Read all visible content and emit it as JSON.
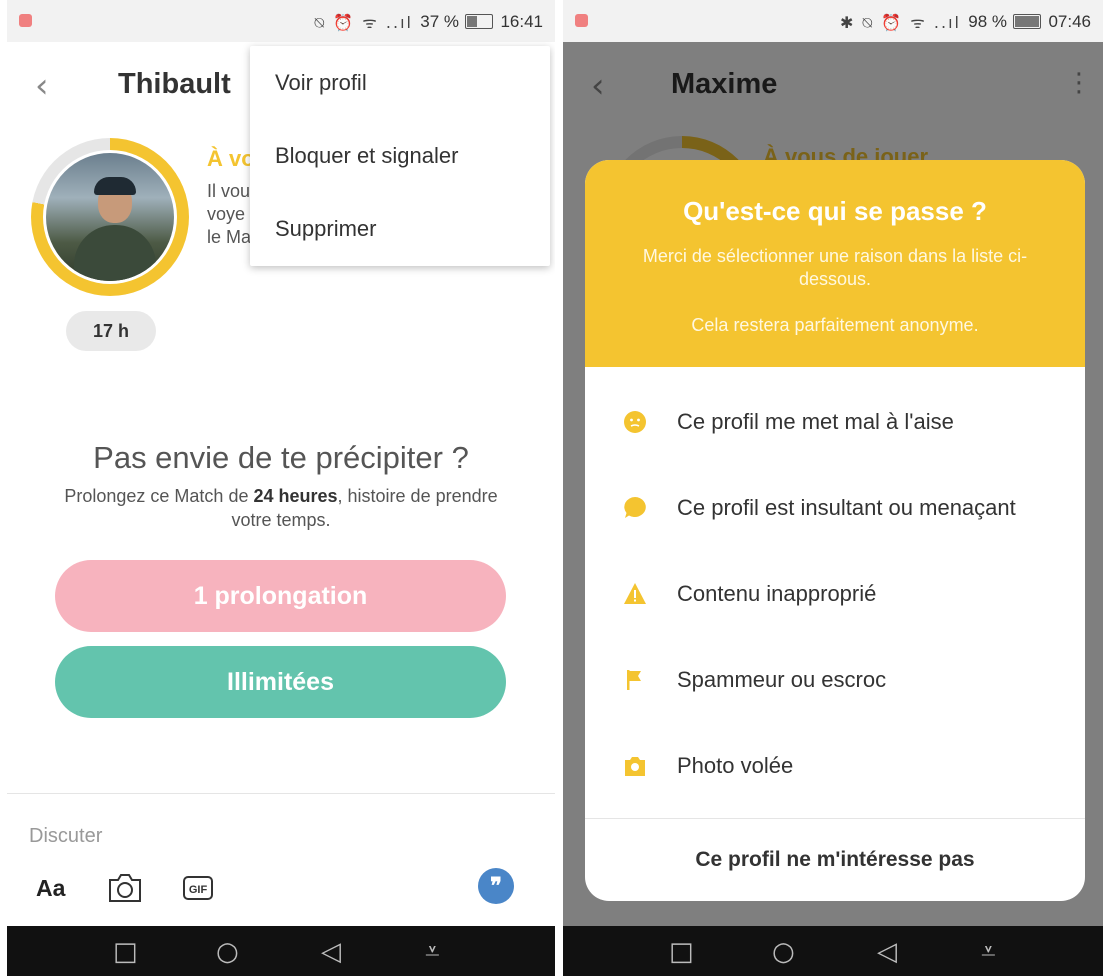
{
  "left": {
    "status": {
      "icons": "⍉ ⏰ ᯤ ..ıl",
      "battery_pct": "37 %",
      "time": "16:41"
    },
    "header": {
      "back": "‹",
      "name": "Thibault"
    },
    "partial_heading": "À vo",
    "partial_lines": [
      "Il vou",
      "voye",
      "le Ma"
    ],
    "time_badge": "17 h",
    "menu": [
      "Voir profil",
      "Bloquer et signaler",
      "Supprimer"
    ],
    "prompt": {
      "title": "Pas envie de te précipiter ?",
      "sub_before": "Prolongez ce Match de ",
      "sub_bold": "24 heures",
      "sub_after": ", histoire de prendre votre temps."
    },
    "buttons": {
      "extend": "1 prolongation",
      "unlimited": "Illimitées"
    },
    "composer": {
      "placeholder": "Discuter",
      "aa": "Aa",
      "gif": "GIF",
      "send": "❞"
    },
    "nav": {
      "square": "□",
      "home": "○",
      "back": "◁",
      "down": "⩡"
    }
  },
  "right": {
    "status": {
      "icons": "✱ ⍉ ⏰ ᯤ ..ıl",
      "battery_pct": "98 %",
      "time": "07:46"
    },
    "header": {
      "back": "‹",
      "name": "Maxime",
      "menu": "⋮"
    },
    "bg_heading": "À vous de jouer",
    "modal": {
      "title": "Qu'est-ce qui se passe ?",
      "subtitle": "Merci de sélectionner une raison dans la liste ci-dessous.",
      "anon": "Cela restera parfaitement anonyme.",
      "reasons": [
        {
          "icon": "uneasy-face-icon",
          "label": "Ce profil me met mal à l'aise"
        },
        {
          "icon": "speech-bubble-icon",
          "label": "Ce profil est insultant ou menaçant"
        },
        {
          "icon": "warning-icon",
          "label": "Contenu inapproprié"
        },
        {
          "icon": "flag-icon",
          "label": "Spammeur ou escroc"
        },
        {
          "icon": "camera-icon",
          "label": "Photo volée"
        }
      ],
      "footer": "Ce profil ne m'intéresse pas"
    },
    "nav": {
      "square": "□",
      "home": "○",
      "back": "◁",
      "down": "⩡"
    }
  },
  "colors": {
    "accent_yellow": "#f4c430",
    "pink": "#f7b3be",
    "green": "#63c4ad",
    "send_blue": "#4a86c8"
  }
}
